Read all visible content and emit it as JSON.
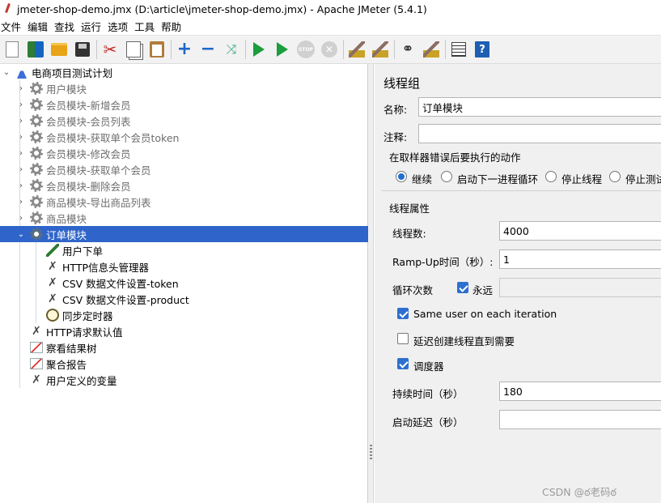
{
  "window": {
    "title": "jmeter-shop-demo.jmx (D:\\article\\jmeter-shop-demo.jmx) - Apache JMeter (5.4.1)"
  },
  "menu": [
    "文件",
    "编辑",
    "查找",
    "运行",
    "选项",
    "工具",
    "帮助"
  ],
  "toolbar": {
    "buttons": [
      "new-icon",
      "templates-icon",
      "open-icon",
      "save-icon",
      "cut-icon",
      "copy-icon",
      "paste-icon",
      "add-icon",
      "remove-icon",
      "expand-icon",
      "start-icon",
      "start-no-pause-icon",
      "stop-icon",
      "shutdown-icon",
      "clear-icon",
      "clear-all-icon",
      "search-icon",
      "reset-search-icon",
      "function-helper-icon",
      "help-icon"
    ],
    "stop_label": "STOP"
  },
  "tree": {
    "root": "电商项目测试计划",
    "thread_groups": [
      "用户模块",
      "会员模块-新增会员",
      "会员模块-会员列表",
      "会员模块-获取单个会员token",
      "会员模块-修改会员",
      "会员模块-获取单个会员",
      "会员模块-删除会员",
      "商品模块-导出商品列表",
      "商品模块"
    ],
    "selected": "订单模块",
    "selected_children": [
      "用户下单",
      "HTTP信息头管理器",
      "CSV 数据文件设置-token",
      "CSV 数据文件设置-product",
      "同步定时器"
    ],
    "plan_elements": [
      "HTTP请求默认值",
      "察看结果树",
      "聚合报告",
      "用户定义的变量"
    ]
  },
  "panel": {
    "title": "线程组",
    "name_label": "名称:",
    "name_value": "订单模块",
    "comment_label": "注释:",
    "comment_value": "",
    "error_action_title": "在取样器错误后要执行的动作",
    "error_actions": [
      "继续",
      "启动下一进程循环",
      "停止线程",
      "停止测试"
    ],
    "error_action_selected": 0,
    "thread_props_title": "线程属性",
    "threads_label": "线程数:",
    "threads_value": "4000",
    "rampup_label": "Ramp-Up时间（秒）:",
    "rampup_value": "1",
    "loop_label": "循环次数",
    "forever_label": "永远",
    "forever_checked": true,
    "loop_value": "",
    "same_user_label": "Same user on each iteration",
    "same_user_checked": true,
    "delay_create_label": "延迟创建线程直到需要",
    "delay_create_checked": false,
    "scheduler_label": "调度器",
    "scheduler_checked": true,
    "duration_label": "持续时间（秒）",
    "duration_value": "180",
    "startup_delay_label": "启动延迟（秒）",
    "startup_delay_value": ""
  },
  "watermark": "CSDN @ఠ老码ఠ"
}
